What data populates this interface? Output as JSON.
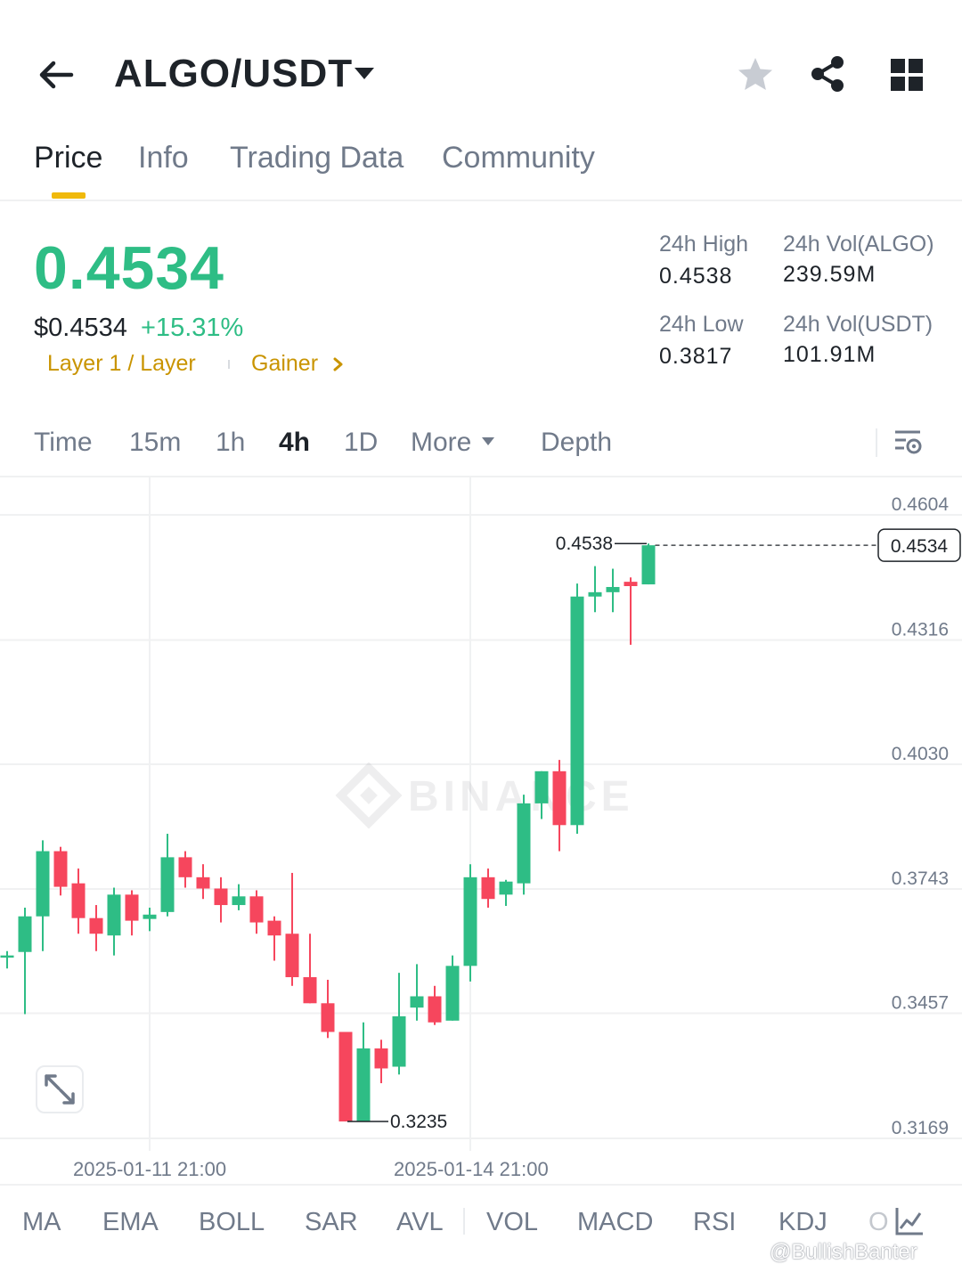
{
  "header": {
    "pair": "ALGO/USDT",
    "back_icon": "arrow-left-icon",
    "caret_icon": "caret-down-icon",
    "star_icon": "star-icon",
    "share_icon": "share-icon",
    "grid_icon": "grid-icon"
  },
  "tabs": [
    {
      "label": "Price",
      "active": true
    },
    {
      "label": "Info"
    },
    {
      "label": "Trading Data"
    },
    {
      "label": "Community"
    }
  ],
  "price": {
    "last": "0.4534",
    "usd": "$0.4534",
    "change": "+15.31%",
    "tags": [
      "Layer 1 / Layer",
      "Gainer"
    ],
    "up_color": "#2EBD85",
    "down_color": "#F6465D",
    "accent_color": "#F0B90B"
  },
  "stats": {
    "high_label": "24h High",
    "high_value": "0.4538",
    "low_label": "24h Low",
    "low_value": "0.3817",
    "vol_base_label": "24h Vol(ALGO)",
    "vol_base_value": "239.59M",
    "vol_quote_label": "24h Vol(USDT)",
    "vol_quote_value": "101.91M"
  },
  "intervals": {
    "items": [
      "Time",
      "15m",
      "1h",
      "4h",
      "1D",
      "More",
      "Depth"
    ],
    "active": "4h",
    "settings_icon": "chart-settings-icon"
  },
  "chart_data": {
    "type": "candlestick",
    "timeframe": "4h",
    "y_ticks": [
      "0.4604",
      "0.4316",
      "0.4030",
      "0.3743",
      "0.3457",
      "0.3169"
    ],
    "ylim": [
      0.3169,
      0.4604
    ],
    "x_labels": [
      "2025-01-11 21:00",
      "2025-01-14 21:00"
    ],
    "high_marker": "0.4538",
    "low_marker": "0.3235",
    "current_price": "0.4534",
    "watermark": "BINANCE",
    "candles": [
      {
        "o": 0.3585,
        "h": 0.36,
        "l": 0.356,
        "c": 0.359
      },
      {
        "o": 0.3598,
        "h": 0.37,
        "l": 0.3455,
        "c": 0.368
      },
      {
        "o": 0.368,
        "h": 0.3855,
        "l": 0.36,
        "c": 0.383
      },
      {
        "o": 0.383,
        "h": 0.384,
        "l": 0.3728,
        "c": 0.3748
      },
      {
        "o": 0.3756,
        "h": 0.379,
        "l": 0.364,
        "c": 0.3676
      },
      {
        "o": 0.3676,
        "h": 0.3706,
        "l": 0.36,
        "c": 0.364
      },
      {
        "o": 0.3636,
        "h": 0.3746,
        "l": 0.359,
        "c": 0.373
      },
      {
        "o": 0.373,
        "h": 0.374,
        "l": 0.3636,
        "c": 0.367
      },
      {
        "o": 0.3674,
        "h": 0.37,
        "l": 0.3646,
        "c": 0.3684
      },
      {
        "o": 0.369,
        "h": 0.387,
        "l": 0.368,
        "c": 0.3816
      },
      {
        "o": 0.3816,
        "h": 0.383,
        "l": 0.3746,
        "c": 0.377
      },
      {
        "o": 0.377,
        "h": 0.38,
        "l": 0.372,
        "c": 0.3744
      },
      {
        "o": 0.3744,
        "h": 0.377,
        "l": 0.3666,
        "c": 0.3706
      },
      {
        "o": 0.3706,
        "h": 0.3754,
        "l": 0.3694,
        "c": 0.3726
      },
      {
        "o": 0.3726,
        "h": 0.374,
        "l": 0.364,
        "c": 0.3666
      },
      {
        "o": 0.367,
        "h": 0.368,
        "l": 0.3578,
        "c": 0.3636
      },
      {
        "o": 0.364,
        "h": 0.378,
        "l": 0.352,
        "c": 0.354
      },
      {
        "o": 0.354,
        "h": 0.364,
        "l": 0.348,
        "c": 0.348
      },
      {
        "o": 0.348,
        "h": 0.3534,
        "l": 0.34,
        "c": 0.3414
      },
      {
        "o": 0.3414,
        "h": 0.3414,
        "l": 0.3208,
        "c": 0.3208
      },
      {
        "o": 0.3208,
        "h": 0.3436,
        "l": 0.3208,
        "c": 0.3376
      },
      {
        "o": 0.3376,
        "h": 0.3396,
        "l": 0.3296,
        "c": 0.333
      },
      {
        "o": 0.3334,
        "h": 0.355,
        "l": 0.3316,
        "c": 0.345
      },
      {
        "o": 0.347,
        "h": 0.357,
        "l": 0.344,
        "c": 0.3496
      },
      {
        "o": 0.3496,
        "h": 0.352,
        "l": 0.343,
        "c": 0.3436
      },
      {
        "o": 0.344,
        "h": 0.359,
        "l": 0.344,
        "c": 0.3566
      },
      {
        "o": 0.3566,
        "h": 0.38,
        "l": 0.353,
        "c": 0.377
      },
      {
        "o": 0.377,
        "h": 0.379,
        "l": 0.37,
        "c": 0.372
      },
      {
        "o": 0.373,
        "h": 0.3764,
        "l": 0.3704,
        "c": 0.376
      },
      {
        "o": 0.3756,
        "h": 0.396,
        "l": 0.373,
        "c": 0.394
      },
      {
        "o": 0.394,
        "h": 0.4014,
        "l": 0.3904,
        "c": 0.4014
      },
      {
        "o": 0.4014,
        "h": 0.404,
        "l": 0.383,
        "c": 0.389
      },
      {
        "o": 0.389,
        "h": 0.4446,
        "l": 0.387,
        "c": 0.4416
      },
      {
        "o": 0.4416,
        "h": 0.4486,
        "l": 0.438,
        "c": 0.4426
      },
      {
        "o": 0.4426,
        "h": 0.448,
        "l": 0.438,
        "c": 0.4438
      },
      {
        "o": 0.445,
        "h": 0.446,
        "l": 0.4305,
        "c": 0.444
      },
      {
        "o": 0.4444,
        "h": 0.4538,
        "l": 0.4444,
        "c": 0.4534
      }
    ]
  },
  "chart_controls": {
    "expand_icon": "expand-icon"
  },
  "indicators": {
    "items": [
      "MA",
      "EMA",
      "BOLL",
      "SAR",
      "AVL",
      "VOL",
      "MACD",
      "RSI",
      "KDJ",
      "O"
    ],
    "chart_icon": "indicator-chart-icon"
  },
  "watermark": "@BullishBanter"
}
